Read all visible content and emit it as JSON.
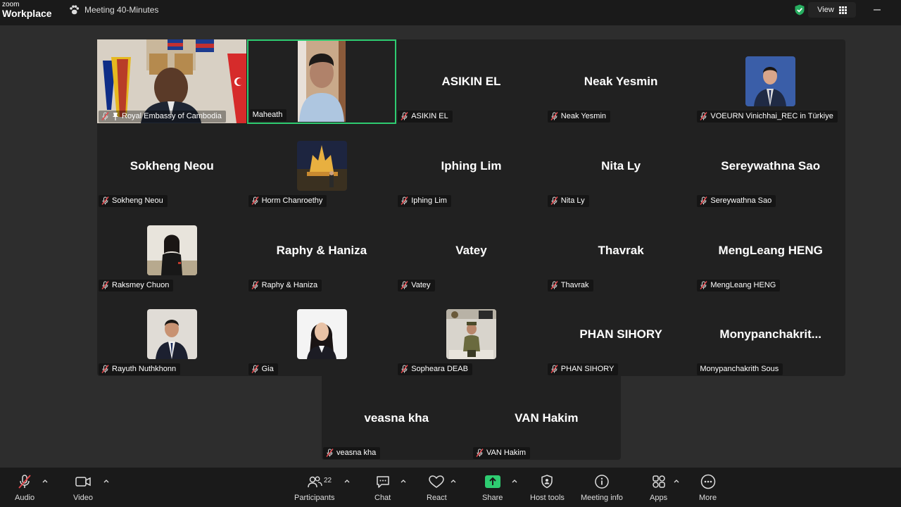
{
  "app": {
    "logo_line1": "zoom",
    "logo_line2": "Workplace",
    "meeting_title": "Meeting 40-Minutes",
    "view_label": "View"
  },
  "tiles": [
    {
      "name": "Royal Embassy of Cambodia",
      "big": "",
      "pinned": true
    },
    {
      "name": "Maheath",
      "big": "",
      "active": true
    },
    {
      "name": "ASIKIN EL",
      "big": "ASIKIN EL"
    },
    {
      "name": "Neak Yesmin",
      "big": "Neak Yesmin"
    },
    {
      "name": "VOEURN Vinichhai_REC in Türkiye",
      "big": ""
    },
    {
      "name": "Sokheng Neou",
      "big": "Sokheng Neou"
    },
    {
      "name": "Horm Chanroethy",
      "big": ""
    },
    {
      "name": "Iphing Lim",
      "big": "Iphing Lim"
    },
    {
      "name": "Nita Ly",
      "big": "Nita Ly"
    },
    {
      "name": "Sereywathna Sao",
      "big": "Sereywathna Sao"
    },
    {
      "name": "Raksmey Chuon",
      "big": ""
    },
    {
      "name": "Raphy & Haniza",
      "big": "Raphy & Haniza"
    },
    {
      "name": "Vatey",
      "big": "Vatey"
    },
    {
      "name": "Thavrak",
      "big": "Thavrak"
    },
    {
      "name": "MengLeang HENG",
      "big": "MengLeang HENG"
    },
    {
      "name": "Rayuth Nuthkhonn",
      "big": ""
    },
    {
      "name": "Gia",
      "big": ""
    },
    {
      "name": "Sopheara DEAB",
      "big": ""
    },
    {
      "name": "PHAN SIHORY",
      "big": "PHAN SIHORY"
    },
    {
      "name": "Monypanchakrith Sous",
      "big": "Monypanchakrit..."
    },
    {
      "name": "veasna kha",
      "big": "veasna kha"
    },
    {
      "name": "VAN Hakim",
      "big": "VAN Hakim"
    }
  ],
  "toolbar": {
    "audio": "Audio",
    "video": "Video",
    "participants": "Participants",
    "participants_count": "22",
    "chat": "Chat",
    "react": "React",
    "share": "Share",
    "host_tools": "Host tools",
    "meeting_info": "Meeting info",
    "apps": "Apps",
    "more": "More"
  },
  "colors": {
    "active_border": "#2ecc71",
    "share_green": "#2ecc71",
    "mute_red": "#e5484d",
    "secure_green": "#27ae60"
  }
}
